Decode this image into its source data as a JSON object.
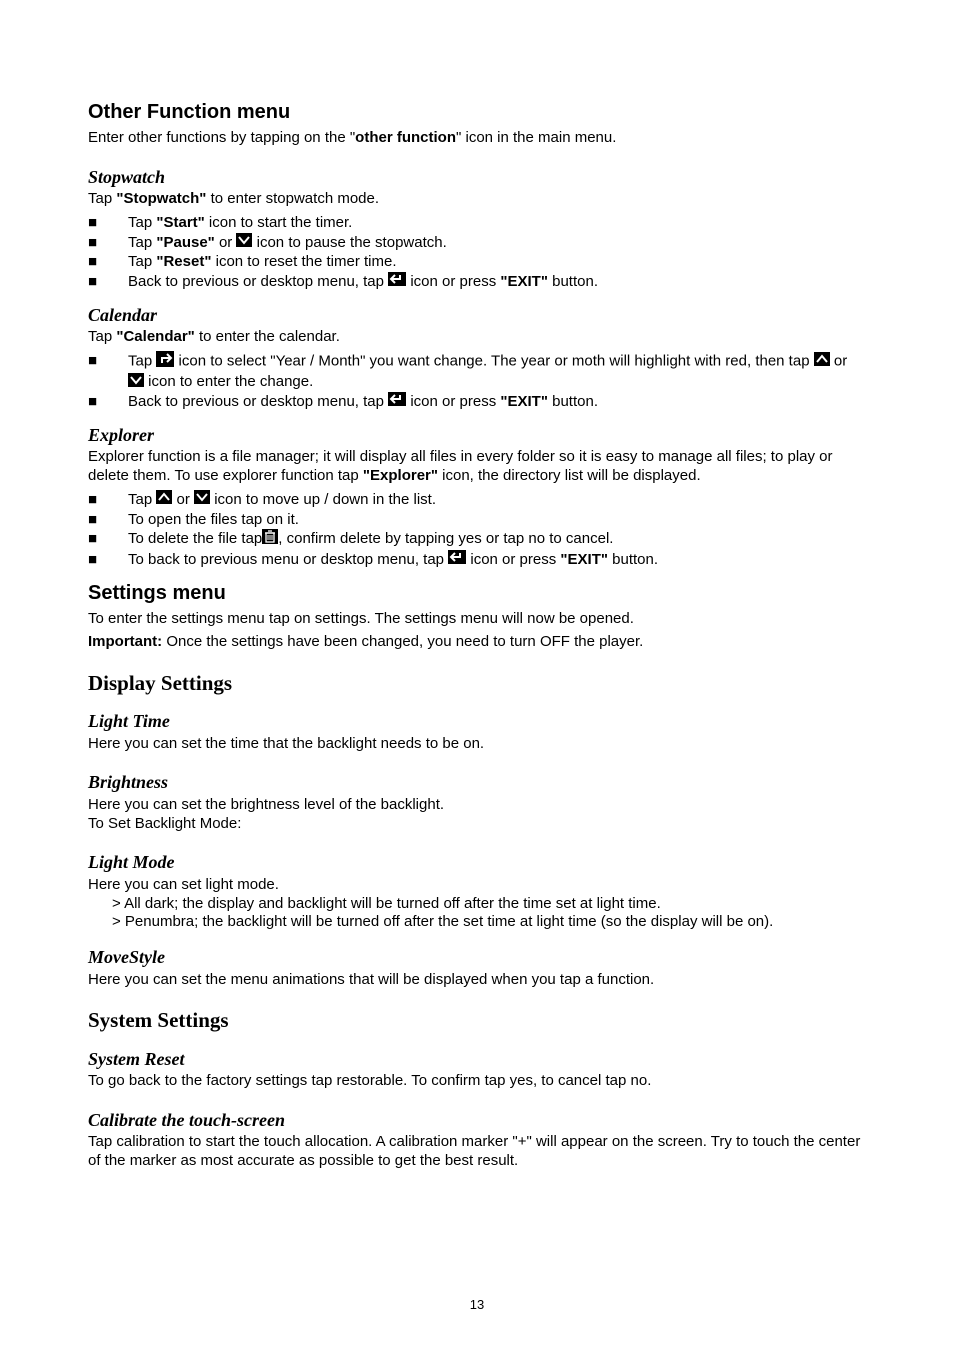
{
  "page_number": "13",
  "s1": {
    "title": "Other Function menu",
    "intro_pre": "Enter other functions by tapping on the \"",
    "intro_bold": "other function",
    "intro_post": "\" icon in the main menu."
  },
  "stopwatch": {
    "title": "Stopwatch",
    "intro_pre": "Tap ",
    "intro_bold": "\"Stopwatch\"",
    "intro_post": " to enter stopwatch mode.",
    "b1": {
      "pre": "Tap ",
      "bold": "\"Start\"",
      "post": " icon to start the timer."
    },
    "b2": {
      "pre": "Tap ",
      "bold": "\"Pause\"",
      "mid": " or ",
      "post": " icon to pause the stopwatch."
    },
    "b3": {
      "pre": "Tap ",
      "bold": "\"Reset\"",
      "post": " icon to reset the timer time."
    },
    "b4": {
      "pre": "Back to previous or desktop menu, tap ",
      "mid": " icon or press ",
      "bold": "\"EXIT\"",
      "post": " button."
    }
  },
  "calendar": {
    "title": "Calendar",
    "intro_pre": "Tap ",
    "intro_bold": "\"Calendar\"",
    "intro_post": " to enter the calendar.",
    "b1": {
      "pre": "Tap ",
      "mid": " icon to select \"Year / Month\" you want change. The year or moth will highlight with red, then tap ",
      "or": " or ",
      "post": " icon to enter the change."
    },
    "b2": {
      "pre": "Back to previous or desktop menu, tap ",
      "mid": " icon or press ",
      "bold": "\"EXIT\"",
      "post": " button."
    }
  },
  "explorer": {
    "title": "Explorer",
    "intro_pre": "Explorer function is a file manager; it will display all files in every folder so it is easy to manage all files; to play or delete them. To use explorer function tap ",
    "intro_bold": "\"Explorer\"",
    "intro_post": " icon, the directory list will be displayed.",
    "b1": {
      "pre": "Tap ",
      "or": " or ",
      "post": " icon to move up / down in the list."
    },
    "b2": {
      "text": "To open the files tap on it."
    },
    "b3": {
      "pre": "To delete the file tap",
      "post": ", confirm delete by tapping yes or tap no to cancel."
    },
    "b4": {
      "pre": "To back to previous menu or desktop menu, tap ",
      "mid": " icon or press ",
      "bold": "\"EXIT\"",
      "post": " button."
    }
  },
  "settings": {
    "title": "Settings menu",
    "p1": "To enter the settings menu tap on settings. The settings menu will now be opened.",
    "p2_bold": "Important:",
    "p2_rest": " Once the settings have been changed, you need to turn OFF the player."
  },
  "display": {
    "title": "Display Settings",
    "light_time": {
      "title": "Light Time",
      "text": "Here you can set the time that the backlight needs to be on."
    },
    "brightness": {
      "title": "Brightness",
      "text1": "Here you can set the brightness level of the backlight.",
      "text2": "To Set Backlight Mode:"
    },
    "light_mode": {
      "title": "Light Mode",
      "text": "Here you can set light mode.",
      "opt1": "> All dark; the display and backlight will be turned off after the time set at light time.",
      "opt2": "> Penumbra; the backlight will be turned off after the set time at light time (so the display will be on)."
    },
    "movestyle": {
      "title": "MoveStyle",
      "text": "Here you can set the menu animations that will be displayed when you tap a function."
    }
  },
  "system": {
    "title": "System Settings",
    "reset": {
      "title": "System Reset",
      "text": "To go back to the factory settings tap restorable. To confirm tap yes, to cancel tap no."
    },
    "calibrate": {
      "title": "Calibrate the touch-screen",
      "text": "Tap calibration to start the touch allocation. A calibration marker \"+\" will appear on the screen. Try to touch the center of the marker as most accurate as possible to get the best result."
    }
  }
}
